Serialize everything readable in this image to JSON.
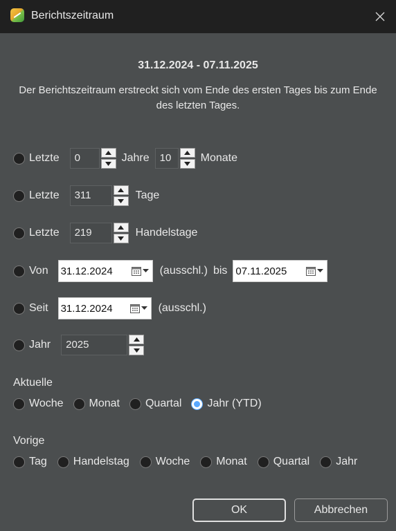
{
  "window": {
    "title": "Berichtszeitraum"
  },
  "header": {
    "range": "31.12.2024 - 07.11.2025",
    "description": "Der Berichtszeitraum erstreckt sich vom Ende des ersten Tages bis zum Ende des letzten Tages."
  },
  "rows": {
    "last_years": {
      "label": "Letzte",
      "years_value": "0",
      "years_label": "Jahre",
      "months_value": "10",
      "months_label": "Monate"
    },
    "last_days": {
      "label": "Letzte",
      "value": "311",
      "unit": "Tage"
    },
    "last_trading_days": {
      "label": "Letzte",
      "value": "219",
      "unit": "Handelstage"
    },
    "from_to": {
      "label": "Von",
      "from_date": "31.12.2024",
      "excl": "(ausschl.)",
      "bis": "bis",
      "to_date": "07.11.2025"
    },
    "since": {
      "label": "Seit",
      "date": "31.12.2024",
      "excl": "(ausschl.)"
    },
    "year": {
      "label": "Jahr",
      "value": "2025"
    }
  },
  "current": {
    "label": "Aktuelle",
    "options": [
      "Woche",
      "Monat",
      "Quartal",
      "Jahr (YTD)"
    ],
    "selected": "Jahr (YTD)"
  },
  "previous": {
    "label": "Vorige",
    "options": [
      "Tag",
      "Handelstag",
      "Woche",
      "Monat",
      "Quartal",
      "Jahr"
    ]
  },
  "buttons": {
    "ok": "OK",
    "cancel": "Abbrechen"
  },
  "colors": {
    "background": "#4b4e4f",
    "titlebar": "#202020",
    "accent": "#59a8ff"
  },
  "icons": {
    "app": "app-logo-icon",
    "close": "close-icon",
    "calendar": "calendar-icon",
    "spin_up": "arrow-up-icon",
    "spin_down": "arrow-down-icon"
  }
}
